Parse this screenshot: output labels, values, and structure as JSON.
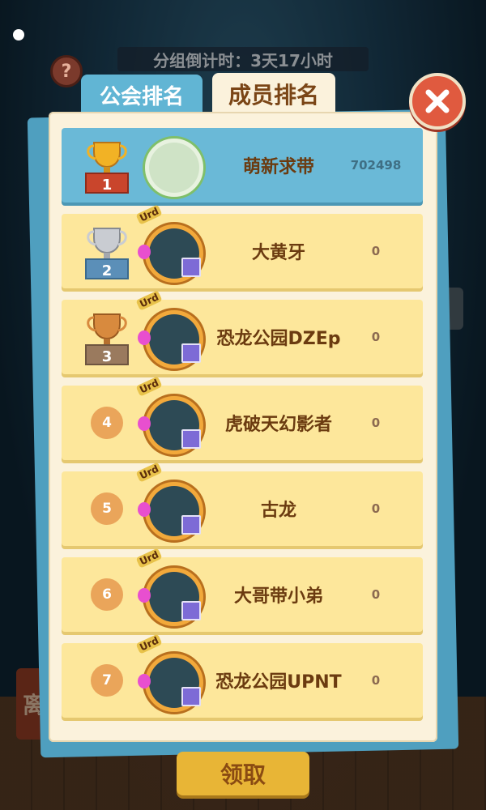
{
  "header": {
    "countdown_text": "分组倒计时：3天17小时",
    "help_label": "?"
  },
  "tabs": [
    {
      "label": "公会排名",
      "active": false
    },
    {
      "label": "成员排名",
      "active": true
    }
  ],
  "background_labels": {
    "left_sign_char": "离"
  },
  "ranking": {
    "rows": [
      {
        "rank": "1",
        "name": "萌新求带",
        "score": "702498",
        "trophy": "gold"
      },
      {
        "rank": "2",
        "name": "大黄牙",
        "score": "0",
        "trophy": "silver"
      },
      {
        "rank": "3",
        "name": "恐龙公园DZEp",
        "score": "0",
        "trophy": "bronze"
      },
      {
        "rank": "4",
        "name": "虎破天幻影者",
        "score": "0"
      },
      {
        "rank": "5",
        "name": "古龙",
        "score": "0"
      },
      {
        "rank": "6",
        "name": "大哥带小弟",
        "score": "0"
      },
      {
        "rank": "7",
        "name": "恐龙公园UPNT",
        "score": "0"
      }
    ],
    "badge_text": "Urd"
  },
  "claim_button": {
    "label": "领取"
  },
  "colors": {
    "guild_tab": "#61b5d4",
    "first_row": "#6ab9d7",
    "row": "#fde79b",
    "close": "#e05a3f",
    "claim": "#e8b536"
  }
}
